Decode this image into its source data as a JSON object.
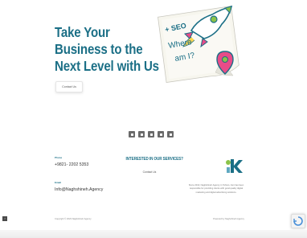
{
  "hero": {
    "title_lines": [
      "Take Your",
      "Business to the",
      "Next Level with Us"
    ],
    "contact_button": "Contact Us",
    "sticky_note": {
      "seo": "+ SEO",
      "line1": "Where",
      "line2": "am I?"
    }
  },
  "social": {
    "icons": [
      "instagram-icon",
      "linkedin-icon",
      "telegram-icon",
      "whatsapp-icon",
      "youtube-icon"
    ]
  },
  "footer": {
    "phone_label": "Phone",
    "phone": "+9821- 2202 5353",
    "email_label": "Email",
    "email": "Info@Naghshineh.Agency",
    "services_title": "INTERESTED IN OUR SERVICES?",
    "services_link": "Contact Us",
    "about": "Since 2010, Naghshineh Agency in Tehran, Iran has been responsible for providing clients with good quality digital marketing and digital advertising solutions.",
    "copyright": "Copyright © 2023 Naghshineh Agency",
    "powered": "Powered by Naghshineh Agency"
  },
  "colors": {
    "brand": "#1b6f86",
    "accent_green": "#8bc34a",
    "accent_pink": "#e84c88"
  }
}
